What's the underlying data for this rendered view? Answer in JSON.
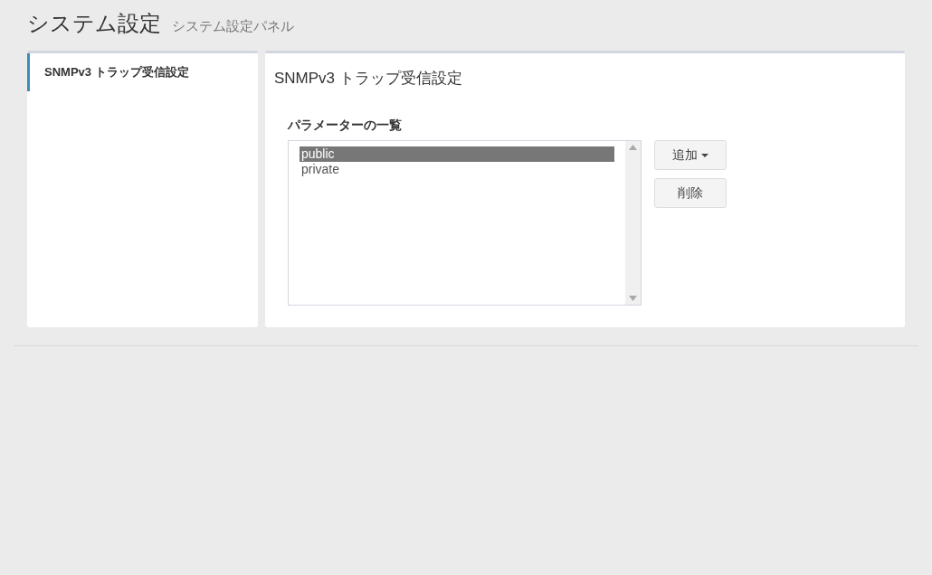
{
  "header": {
    "title": "システム設定",
    "subtitle": "システム設定パネル"
  },
  "sidebar": {
    "items": [
      {
        "label": "SNMPv3 トラップ受信設定",
        "selected": true
      }
    ]
  },
  "panel": {
    "title": "SNMPv3 トラップ受信設定",
    "list_label": "パラメーターの一覧",
    "list_items": [
      {
        "label": "public",
        "selected": true
      },
      {
        "label": "private",
        "selected": false
      }
    ],
    "buttons": [
      {
        "label": "追加",
        "kind": "dropdown"
      },
      {
        "label": "削除",
        "kind": "plain"
      }
    ]
  }
}
